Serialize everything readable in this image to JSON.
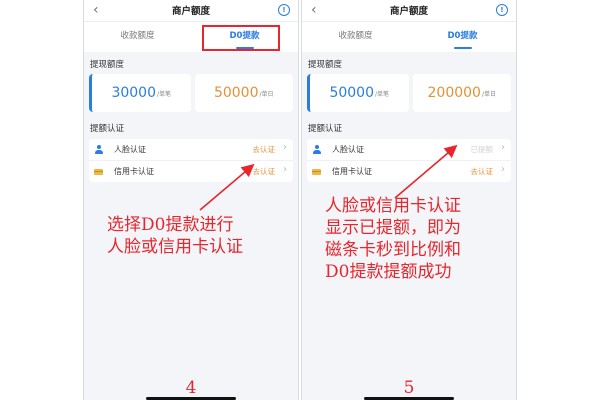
{
  "screens": [
    {
      "header": {
        "title": "商户额度"
      },
      "tabs": [
        {
          "label": "收款额度"
        },
        {
          "label": "D0提款"
        }
      ],
      "limits_section": {
        "label": "提现额度",
        "cards": [
          {
            "value": "30000",
            "unit": "/单笔"
          },
          {
            "value": "50000",
            "unit": "/单日"
          }
        ]
      },
      "auth_section": {
        "label": "提额认证",
        "rows": [
          {
            "icon": "face-id-icon",
            "label": "人脸认证",
            "status": "去认证"
          },
          {
            "icon": "credit-card-icon",
            "label": "信用卡认证",
            "status": "去认证"
          }
        ]
      },
      "step": "4",
      "annotation": [
        "选择D0提款进行",
        "人脸或信用卡认证"
      ]
    },
    {
      "header": {
        "title": "商户额度"
      },
      "tabs": [
        {
          "label": "收款额度"
        },
        {
          "label": "D0提款"
        }
      ],
      "limits_section": {
        "label": "提现额度",
        "cards": [
          {
            "value": "50000",
            "unit": "/单笔"
          },
          {
            "value": "200000",
            "unit": "/单日"
          }
        ]
      },
      "auth_section": {
        "label": "提额认证",
        "rows": [
          {
            "icon": "face-id-icon",
            "label": "人脸认证",
            "status": "已提额"
          },
          {
            "icon": "credit-card-icon",
            "label": "信用卡认证",
            "status": "去认证"
          }
        ]
      },
      "step": "5",
      "annotation": [
        "人脸或信用卡认证",
        "显示已提额，即为",
        "磁条卡秒到比例和",
        "D0提款提额成功"
      ]
    }
  ],
  "colors": {
    "accent": "#2a7de1",
    "orange": "#e29237",
    "annotation_red": "#e8262d",
    "background": "#f3f5f9"
  }
}
